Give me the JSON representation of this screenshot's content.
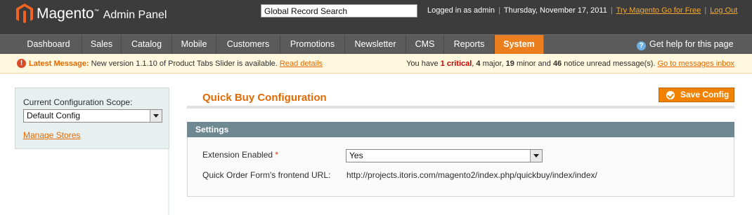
{
  "header": {
    "app_title": "Magento",
    "app_subtitle": "Admin Panel",
    "search_value": "Global Record Search",
    "logged_in": "Logged in as admin",
    "date": "Thursday, November 17, 2011",
    "try_link": "Try Magento Go for Free",
    "logout_link": "Log Out"
  },
  "nav": {
    "items": [
      {
        "label": "Dashboard"
      },
      {
        "label": "Sales"
      },
      {
        "label": "Catalog"
      },
      {
        "label": "Mobile"
      },
      {
        "label": "Customers"
      },
      {
        "label": "Promotions"
      },
      {
        "label": "Newsletter"
      },
      {
        "label": "CMS"
      },
      {
        "label": "Reports"
      },
      {
        "label": "System"
      }
    ],
    "active": "System",
    "help_label": "Get help for this page"
  },
  "notice": {
    "latest_label": "Latest Message:",
    "message": "New version 1.1.10 of Product Tabs Slider is available.",
    "read_details": "Read details",
    "you_have": "You have",
    "critical_count": "1 critical",
    "major_count": "4",
    "major_label": "major,",
    "minor_count": "19",
    "minor_label": "minor and",
    "notice_count": "46",
    "notice_label": "notice unread message(s).",
    "inbox_link": "Go to messages inbox"
  },
  "scope": {
    "label": "Current Configuration Scope:",
    "value": "Default Config",
    "manage_stores": "Manage Stores"
  },
  "main": {
    "title": "Quick Buy Configuration",
    "save_button": "Save Config",
    "section_title": "Settings",
    "fields": {
      "extension_enabled_label": "Extension Enabled",
      "required_mark": "*",
      "extension_enabled_value": "Yes",
      "frontend_url_label": "Quick Order Form's frontend URL:",
      "frontend_url_value": "http://projects.itoris.com/magento2/index.php/quickbuy/index/index/"
    }
  },
  "colors": {
    "header_bg": "#3c3c3c",
    "nav_bg": "#5b5b5b",
    "accent": "#eb7f1f",
    "link": "#e26900",
    "section_head": "#6f8992"
  }
}
